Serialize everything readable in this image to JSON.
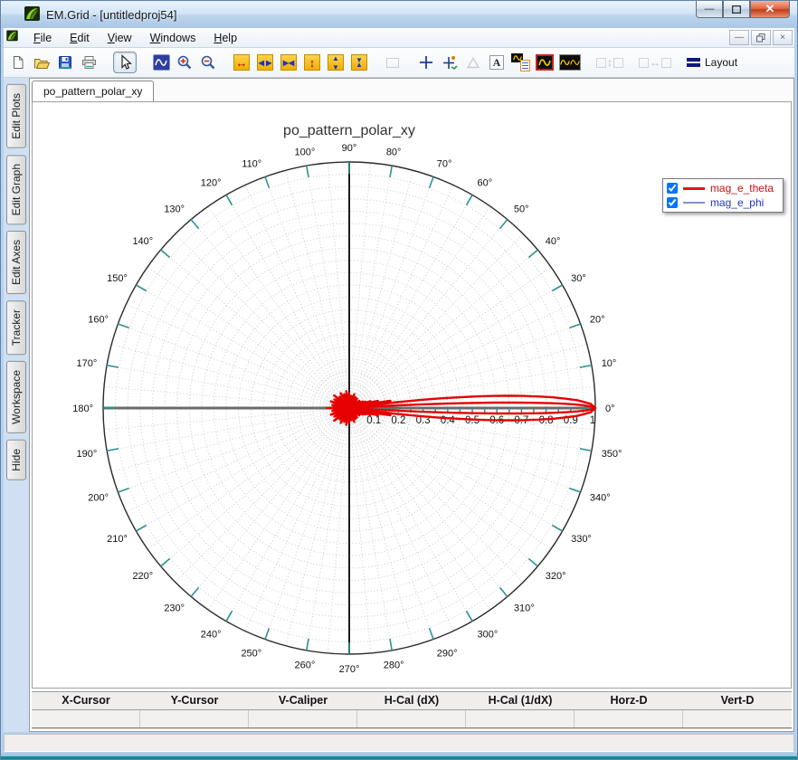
{
  "window": {
    "title": "EM.Grid - [untitledproj54]",
    "buttons": {
      "minimize": "minimize",
      "maximize": "maximize",
      "close": "close"
    }
  },
  "menu": {
    "items": [
      "File",
      "Edit",
      "View",
      "Windows",
      "Help"
    ]
  },
  "toolbar": {
    "groups": [
      [
        {
          "name": "new-file-button",
          "icon": "doc-new"
        },
        {
          "name": "open-file-button",
          "icon": "folder-open"
        },
        {
          "name": "save-file-button",
          "icon": "floppy-save"
        },
        {
          "name": "print-button",
          "icon": "printer"
        }
      ],
      [
        {
          "name": "pointer-tool-button",
          "icon": "pointer",
          "pressed": true
        }
      ],
      [
        {
          "name": "zoom-region-button",
          "icon": "zoom-region"
        },
        {
          "name": "zoom-in-button",
          "icon": "zoom-in"
        },
        {
          "name": "zoom-out-button",
          "icon": "zoom-out"
        }
      ],
      [
        {
          "name": "expand-horizontal-button",
          "icon": "h-expand"
        },
        {
          "name": "fit-horizontal-button",
          "icon": "h-fit"
        },
        {
          "name": "shrink-horizontal-button",
          "icon": "h-shrink"
        },
        {
          "name": "expand-vertical-button",
          "icon": "v-expand"
        },
        {
          "name": "fit-vertical-button",
          "icon": "v-fit"
        },
        {
          "name": "shrink-vertical-button",
          "icon": "v-shrink"
        }
      ],
      [
        {
          "name": "rectangle-zone-button",
          "icon": "rect-zone",
          "disabled": true
        }
      ],
      [
        {
          "name": "crosshair-cursor-button",
          "icon": "crosshair"
        },
        {
          "name": "tracker-button",
          "icon": "tracker"
        },
        {
          "name": "triangle-marker-button",
          "icon": "triangle",
          "disabled": true
        },
        {
          "name": "text-annotation-button",
          "icon": "text-a"
        },
        {
          "name": "legend-toggle-button",
          "icon": "legend"
        },
        {
          "name": "curve-style-button",
          "icon": "curve-red"
        },
        {
          "name": "overlay-curves-button",
          "icon": "curves-multi"
        }
      ],
      [
        {
          "name": "align-vertical-plots-button",
          "icon": "pair-v",
          "disabled": true
        }
      ],
      [
        {
          "name": "align-horizontal-plots-button",
          "icon": "pair-h",
          "disabled": true
        }
      ],
      [
        {
          "name": "layout-button",
          "icon": "layout",
          "label": "Layout"
        }
      ]
    ],
    "layout_label": "Layout"
  },
  "sidebar": {
    "tabs": [
      "Edit Plots",
      "Edit Graph",
      "Edit Axes",
      "Tracker",
      "Workspace",
      "Hide"
    ]
  },
  "document": {
    "tab_label": "po_pattern_polar_xy"
  },
  "legend": {
    "entries": [
      {
        "label": "mag_e_theta",
        "checked": true,
        "text_color": "#cc1111",
        "line_color": "#ee1111",
        "line_height": 3
      },
      {
        "label": "mag_e_phi",
        "checked": true,
        "text_color": "#2233cc",
        "line_color": "#8a8fd0",
        "line_height": 2
      }
    ]
  },
  "cursor_bar": {
    "columns": [
      "X-Cursor",
      "Y-Cursor",
      "V-Caliper",
      "H-Cal (dX)",
      "H-Cal (1/dX)",
      "Horz-D",
      "Vert-D"
    ],
    "values": [
      "",
      "",
      "",
      "",
      "",
      "",
      ""
    ]
  },
  "chart_data": {
    "type": "line",
    "subtype": "polar",
    "title": "po_pattern_polar_xy",
    "angle_unit": "degrees",
    "rlim": [
      0,
      1
    ],
    "grid": {
      "circle_step": 0.05,
      "radial_line_step_deg": 5,
      "rim_tick_step_deg": 10,
      "axis_tick_step": 0.05
    },
    "angle_labels": [
      "0°",
      "10°",
      "20°",
      "30°",
      "40°",
      "50°",
      "60°",
      "70°",
      "80°",
      "90°",
      "100°",
      "110°",
      "120°",
      "130°",
      "140°",
      "150°",
      "160°",
      "170°",
      "180°",
      "190°",
      "200°",
      "210°",
      "220°",
      "230°",
      "240°",
      "250°",
      "260°",
      "270°",
      "280°",
      "290°",
      "300°",
      "310°",
      "320°",
      "330°",
      "340°",
      "350°"
    ],
    "radial_labels": [
      "0.1",
      "0.2",
      "0.3",
      "0.4",
      "0.5",
      "0.6",
      "0.7",
      "0.8",
      "0.9",
      "1"
    ],
    "colors": {
      "grid": "#cbcbcb",
      "rim": "#2a2a2a",
      "ticks": "#2e9191",
      "h_axis": "#6b6b6b",
      "v_axis": "#1c1c1c"
    },
    "series": [
      {
        "name": "mag_e_theta",
        "color": "#e60000",
        "width": 2.4,
        "symmetric_about_0deg": true,
        "samples_theta_deg_r": [
          [
            0,
            1.0
          ],
          [
            1,
            0.981
          ],
          [
            2,
            0.924
          ],
          [
            3,
            0.831
          ],
          [
            4,
            0.707
          ],
          [
            5,
            0.556
          ],
          [
            6,
            0.383
          ],
          [
            7,
            0.195
          ],
          [
            7.5,
            0.098
          ],
          [
            8,
            0
          ],
          [
            9,
            0.11
          ],
          [
            10,
            0.17
          ],
          [
            11,
            0.11
          ],
          [
            12,
            0
          ],
          [
            13,
            0.08
          ],
          [
            14,
            0.12
          ],
          [
            15,
            0.08
          ],
          [
            16,
            0
          ],
          [
            17,
            0.06
          ],
          [
            18,
            0.09
          ],
          [
            19,
            0.06
          ],
          [
            20,
            0
          ],
          [
            22,
            0.07
          ],
          [
            24,
            0
          ],
          [
            26,
            0.06
          ],
          [
            28,
            0
          ],
          [
            30,
            0.05
          ],
          [
            33,
            0
          ],
          [
            36,
            0.05
          ],
          [
            39,
            0
          ],
          [
            42,
            0.04
          ],
          [
            45,
            0
          ],
          [
            50,
            0.05
          ],
          [
            55,
            0
          ],
          [
            60,
            0.05
          ],
          [
            65,
            0
          ],
          [
            70,
            0.06
          ],
          [
            75,
            0
          ],
          [
            80,
            0.05
          ],
          [
            85,
            0
          ],
          [
            90,
            0.06
          ],
          [
            95,
            0
          ],
          [
            100,
            0.07
          ],
          [
            105,
            0
          ],
          [
            110,
            0.06
          ],
          [
            115,
            0
          ],
          [
            120,
            0.07
          ],
          [
            125,
            0
          ],
          [
            130,
            0.06
          ],
          [
            135,
            0
          ],
          [
            140,
            0.08
          ],
          [
            145,
            0
          ],
          [
            150,
            0.07
          ],
          [
            155,
            0
          ],
          [
            160,
            0.08
          ],
          [
            165,
            0
          ],
          [
            170,
            0.07
          ],
          [
            175,
            0
          ],
          [
            180,
            0.09
          ]
        ],
        "inner_lobe_theta_deg_r": [
          [
            0,
            1.0
          ],
          [
            0.5,
            0.976
          ],
          [
            1,
            0.906
          ],
          [
            1.5,
            0.79
          ],
          [
            2,
            0.64
          ],
          [
            2.5,
            0.46
          ],
          [
            3,
            0.26
          ],
          [
            3.3,
            0.14
          ],
          [
            3.6,
            0
          ]
        ]
      },
      {
        "name": "mag_e_phi",
        "color": "#8a8fd0",
        "width": 1.6,
        "symmetric_about_0deg": true,
        "samples_theta_deg_r": [
          [
            0,
            0.012
          ],
          [
            45,
            0.009
          ],
          [
            90,
            0.012
          ],
          [
            135,
            0.009
          ],
          [
            180,
            0.012
          ]
        ]
      }
    ]
  }
}
